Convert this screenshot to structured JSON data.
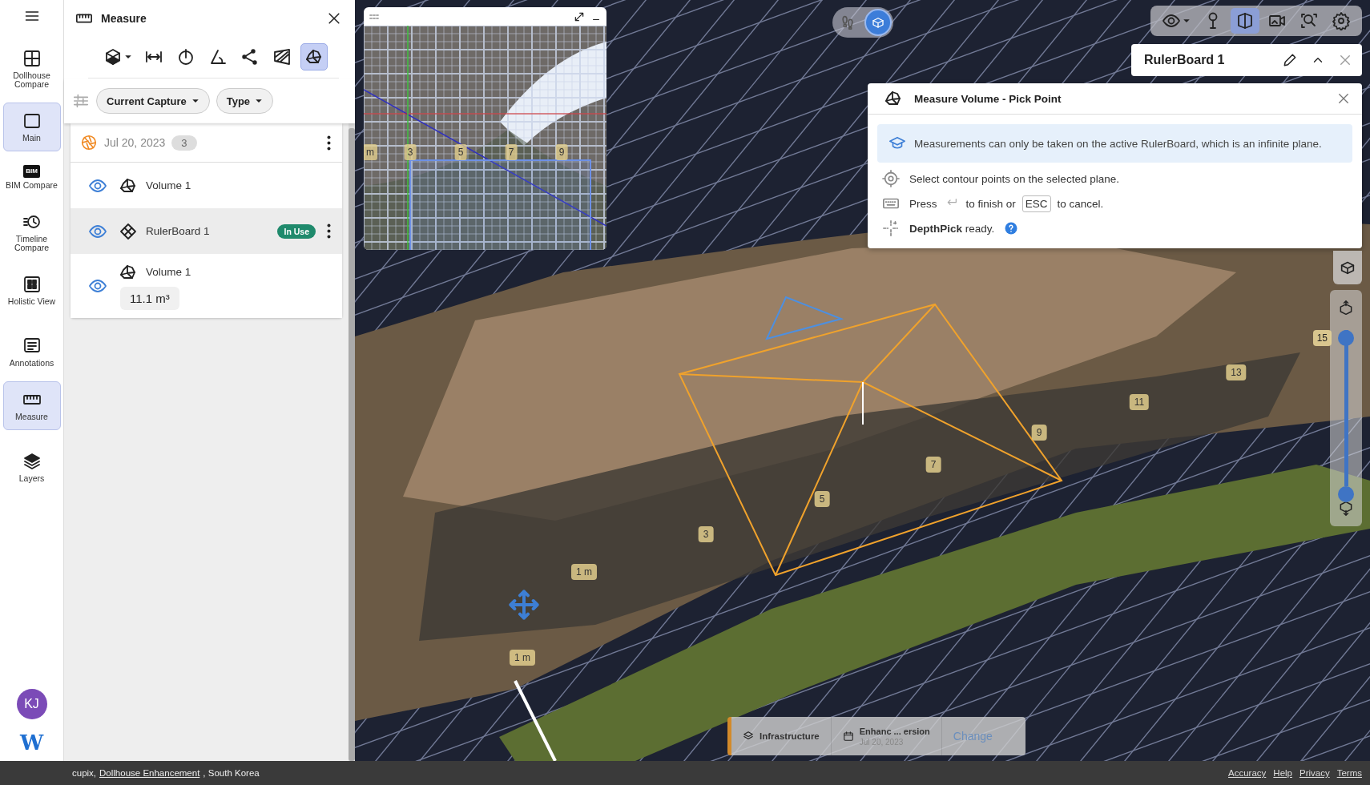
{
  "rail": {
    "items": [
      {
        "kind": "dollhouse",
        "label": "Dollhouse Compare",
        "selected": false
      },
      {
        "kind": "main",
        "label": "Main",
        "selected": true
      },
      {
        "kind": "bim",
        "label": "BIM Compare",
        "icon_text": "BIM",
        "selected": false
      },
      {
        "kind": "timeline",
        "label": "Timeline Compare",
        "selected": false
      },
      {
        "kind": "holistic",
        "label": "Holistic View",
        "selected": false
      },
      {
        "kind": "annotations",
        "label": "Annotations",
        "selected": false
      },
      {
        "kind": "measure",
        "label": "Measure",
        "selected": true
      },
      {
        "kind": "layers",
        "label": "Layers",
        "selected": false
      }
    ],
    "avatar": "KJ",
    "logo": "W"
  },
  "panel": {
    "title": "Measure",
    "tools": [
      {
        "kind": "solid",
        "dropdown": true,
        "selected": false
      },
      {
        "kind": "distance",
        "dropdown": false,
        "selected": false
      },
      {
        "kind": "height",
        "dropdown": false,
        "selected": false
      },
      {
        "kind": "angle",
        "dropdown": false,
        "selected": false
      },
      {
        "kind": "polyline",
        "dropdown": false,
        "selected": false
      },
      {
        "kind": "area",
        "dropdown": false,
        "selected": false
      },
      {
        "kind": "volume",
        "dropdown": false,
        "selected": true
      }
    ],
    "filters": [
      {
        "label": "Current Capture"
      },
      {
        "label": "Type"
      }
    ],
    "group": {
      "date": "Jul 20, 2023",
      "count": "3"
    },
    "items": [
      {
        "kind": "volume",
        "name": "Volume 1",
        "selected": false,
        "menu": false
      },
      {
        "kind": "rulerboard",
        "name": "RulerBoard 1",
        "badge": "In Use",
        "selected": true,
        "menu": true
      },
      {
        "kind": "volume",
        "name": "Volume 1",
        "value": "11.1 m³",
        "selected": false,
        "menu": false
      }
    ]
  },
  "minimap": {
    "labels": [
      "m",
      "3",
      "5",
      "7",
      "9"
    ]
  },
  "mode_buttons": [
    {
      "kind": "walk",
      "selected": false
    },
    {
      "kind": "box",
      "selected": true
    }
  ],
  "toolbar": [
    {
      "kind": "eye",
      "dropdown": true,
      "selected": false
    },
    {
      "kind": "pin",
      "dropdown": false,
      "selected": false
    },
    {
      "kind": "plane",
      "dropdown": false,
      "selected": true
    },
    {
      "kind": "camera",
      "dropdown": false,
      "selected": false
    },
    {
      "kind": "zoom",
      "dropdown": false,
      "selected": false
    },
    {
      "kind": "settings",
      "dropdown": false,
      "selected": false
    }
  ],
  "rulerboard_bar": {
    "title": "RulerBoard 1"
  },
  "dialog": {
    "title": "Measure Volume - Pick Point",
    "info": "Measurements can only be taken on the active RulerBoard, which is an infinite plane.",
    "select_step": "Select contour points on the selected plane.",
    "keys_step": {
      "press": "Press",
      "finish": "to finish or",
      "key": "ESC",
      "cancel": "to cancel."
    },
    "depthpick": "**DepthPick** ready."
  },
  "scene_labels": [
    "1 m",
    "1 m",
    "3",
    "5",
    "7",
    "9",
    "11",
    "13"
  ],
  "height_slider": {
    "reading": "15",
    "thumbs": [
      {
        "level": 1
      },
      {
        "level": 0
      }
    ]
  },
  "version_chip": {
    "layer": "Infrastructure",
    "version": "Enhanc ... ersion",
    "date": "Jul 20, 2023",
    "action": "Change"
  },
  "status_bar": {
    "prefix": "cupix,",
    "link": "Dollhouse Enhancement",
    "suffix": ", South Korea",
    "links": [
      "Accuracy",
      "Help",
      "Privacy",
      "Terms"
    ]
  }
}
